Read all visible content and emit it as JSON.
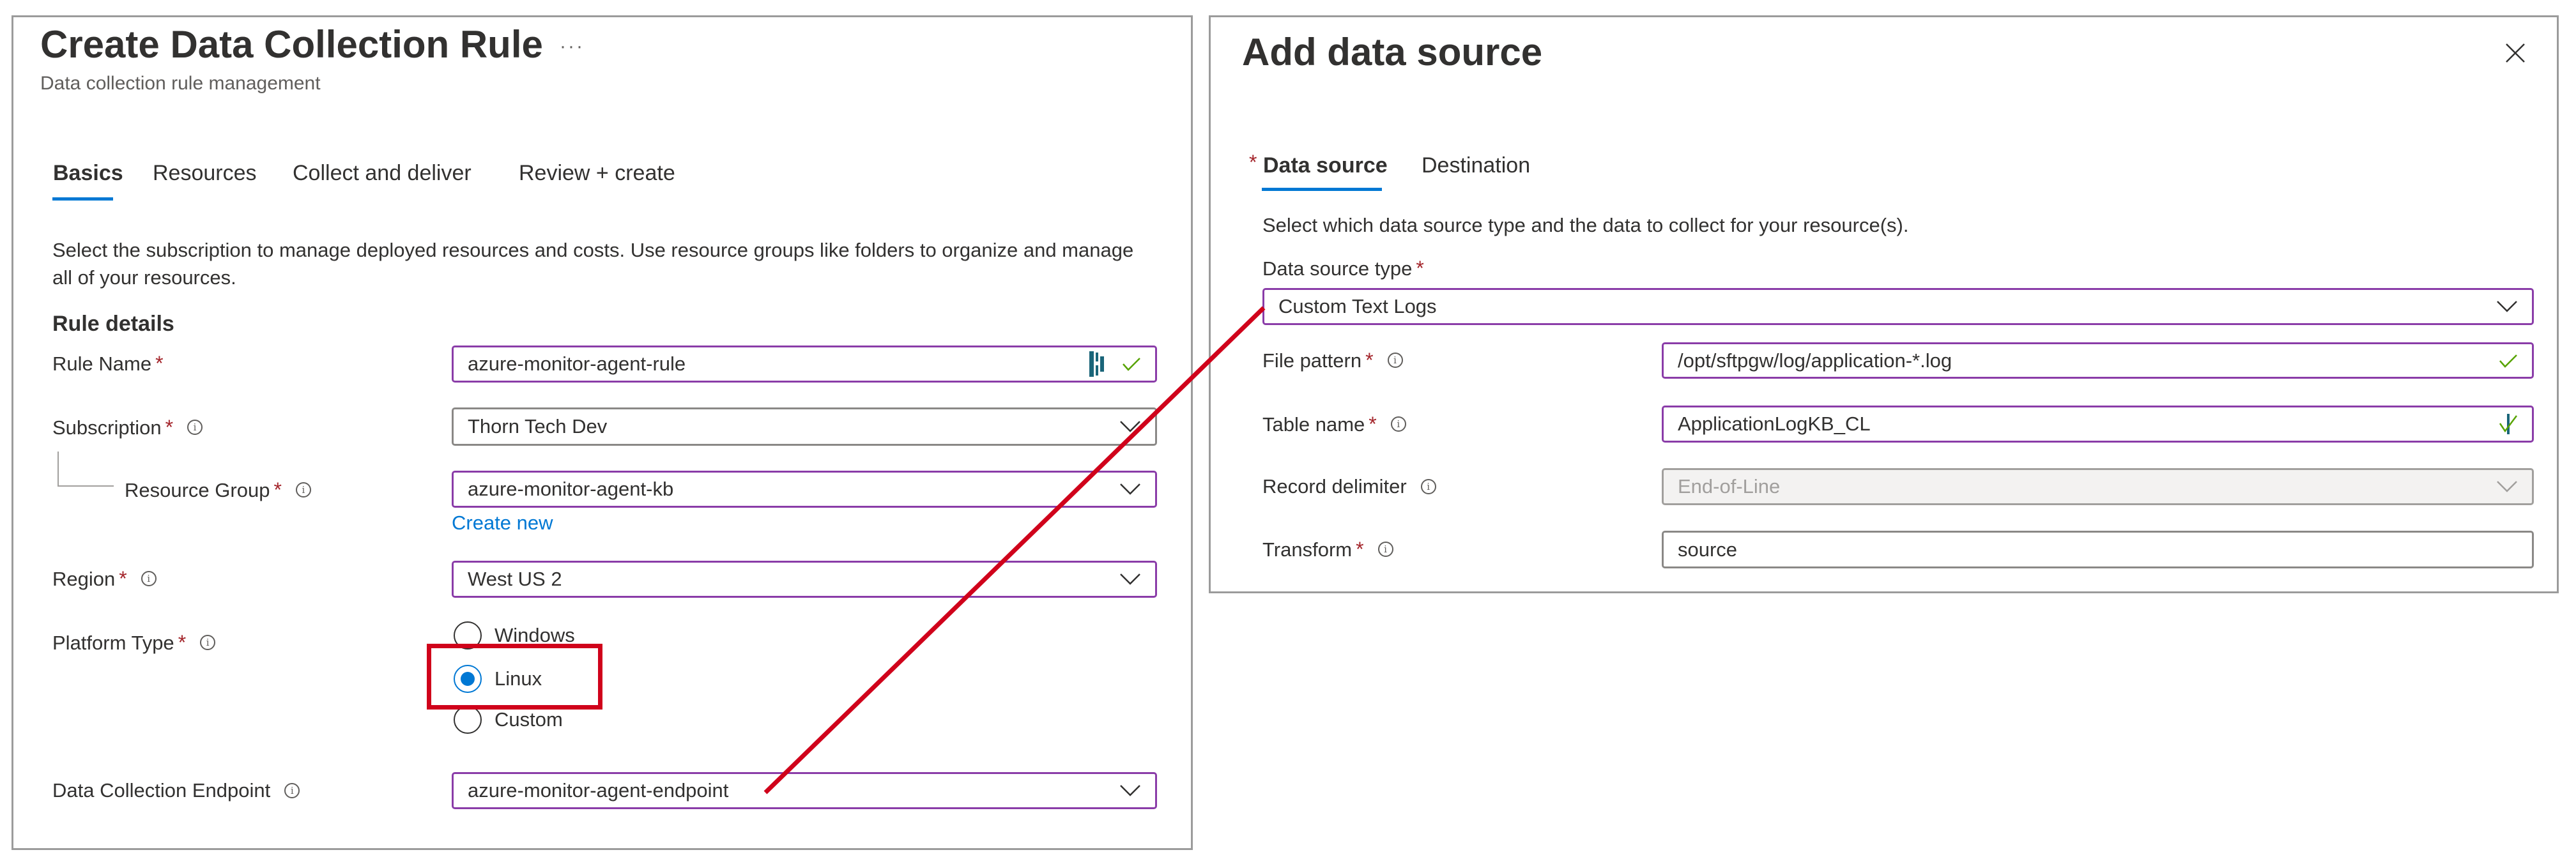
{
  "left_panel": {
    "title": "Create Data Collection Rule",
    "more_label": "···",
    "subtitle": "Data collection rule management",
    "tabs": [
      {
        "label": "Basics",
        "active": true
      },
      {
        "label": "Resources",
        "active": false
      },
      {
        "label": "Collect and deliver",
        "active": false
      },
      {
        "label": "Review + create",
        "active": false
      }
    ],
    "description": "Select the subscription to manage deployed resources and costs. Use resource groups like folders to organize and manage all of your resources.",
    "section_heading": "Rule details",
    "fields": {
      "rule_name": {
        "label": "Rule Name",
        "required": "*",
        "value": "azure-monitor-agent-rule",
        "status_icon": "check-icon",
        "extra_icon": "password-manager-icon"
      },
      "subscription": {
        "label": "Subscription",
        "required": "*",
        "value": "Thorn Tech Dev",
        "icon": "chevron-down-icon"
      },
      "resource_group": {
        "label": "Resource Group",
        "required": "*",
        "value": "azure-monitor-agent-kb",
        "create_new_label": "Create new"
      },
      "region": {
        "label": "Region",
        "required": "*",
        "value": "West US 2"
      },
      "platform_type": {
        "label": "Platform Type",
        "required": "*",
        "options": [
          {
            "label": "Windows",
            "checked": false
          },
          {
            "label": "Linux",
            "checked": true
          },
          {
            "label": "Custom",
            "checked": false
          }
        ]
      },
      "data_collection_endpoint": {
        "label": "Data Collection Endpoint",
        "value": "azure-monitor-agent-endpoint"
      }
    },
    "info_glyph": "i"
  },
  "right_panel": {
    "title": "Add data source",
    "close_icon": "close-icon",
    "tabs": [
      {
        "label": "Data source",
        "required": "*",
        "active": true
      },
      {
        "label": "Destination",
        "active": false
      }
    ],
    "description": "Select which data source type and the data to collect for your resource(s).",
    "fields": {
      "data_source_type": {
        "label": "Data source type",
        "required": "*",
        "value": "Custom Text Logs"
      },
      "file_pattern": {
        "label": "File pattern",
        "required": "*",
        "value": "/opt/sftpgw/log/application-*.log"
      },
      "table_name": {
        "label": "Table name",
        "required": "*",
        "value": "ApplicationLogKB_CL"
      },
      "record_delimiter": {
        "label": "Record delimiter",
        "value": "End-of-Line",
        "disabled": true
      },
      "transform": {
        "label": "Transform",
        "required": "*",
        "value": "source"
      }
    }
  },
  "annotations": {
    "highlight_color": "#d0021b",
    "highlight_target": "Linux",
    "connector_from": "Data Collection Endpoint field",
    "connector_to": "Data source type field"
  },
  "colors": {
    "accent": "#0078d4",
    "focus_border": "#8a3ca8",
    "required": "#a4262c",
    "success": "#57a300"
  }
}
